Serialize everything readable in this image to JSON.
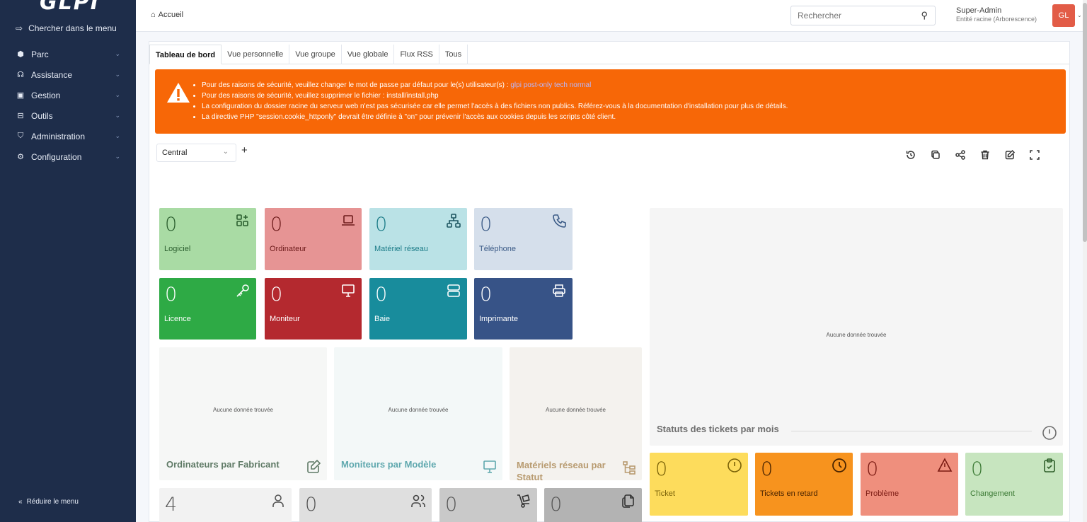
{
  "sidebar": {
    "logo": "GLPI",
    "search_menu": "Chercher dans le menu",
    "items": [
      {
        "label": "Parc",
        "icon": "cube-icon"
      },
      {
        "label": "Assistance",
        "icon": "headset-icon"
      },
      {
        "label": "Gestion",
        "icon": "wallet-icon"
      },
      {
        "label": "Outils",
        "icon": "briefcase-icon"
      },
      {
        "label": "Administration",
        "icon": "shield-icon"
      },
      {
        "label": "Configuration",
        "icon": "settings-icon"
      }
    ],
    "collapse": "Réduire le menu"
  },
  "header": {
    "breadcrumb": "Accueil",
    "search_placeholder": "Rechercher",
    "user_role": "Super-Admin",
    "user_entity": "Entité racine (Arborescence)",
    "avatar_initials": "GL"
  },
  "tabs": [
    "Tableau de bord",
    "Vue personnelle",
    "Vue groupe",
    "Vue globale",
    "Flux RSS",
    "Tous"
  ],
  "alert": {
    "line1_text": "Pour des raisons de sécurité, veuillez changer le mot de passe par défaut pour le(s) utilisateur(s) :",
    "line1_users": "glpi post-only tech normal",
    "line2": "Pour des raisons de sécurité, veuillez supprimer le fichier : install/install.php",
    "line3": "La configuration du dossier racine du serveur web n'est pas sécurisée car elle permet l'accès à des fichiers non publics. Référez-vous à la documentation d'installation pour plus de détails.",
    "line4": "La directive PHP \"session.cookie_httponly\" devrait être définie à \"on\" pour prévenir l'accès aux cookies depuis les scripts côté client."
  },
  "dashboard": {
    "selected": "Central",
    "add": "+"
  },
  "cards": {
    "logiciel": {
      "value": "0",
      "label": "Logiciel",
      "color": "#a9dba4"
    },
    "ordinateur": {
      "value": "0",
      "label": "Ordinateur",
      "color": "#e69494"
    },
    "materiel": {
      "value": "0",
      "label": "Matériel réseau",
      "color": "#bae2e6"
    },
    "telephone": {
      "value": "0",
      "label": "Téléphone",
      "color": "#d5dfeb"
    },
    "licence": {
      "value": "0",
      "label": "Licence",
      "color": "#2eaa45"
    },
    "moniteur": {
      "value": "0",
      "label": "Moniteur",
      "color": "#b4292f"
    },
    "baie": {
      "value": "0",
      "label": "Baie",
      "color": "#188c9c"
    },
    "imprimante": {
      "value": "0",
      "label": "Imprimante",
      "color": "#375387"
    },
    "ticket": {
      "value": "0",
      "label": "Ticket",
      "color": "#fddc5c"
    },
    "retard": {
      "value": "0",
      "label": "Tickets en retard",
      "color": "#f7931e"
    },
    "probleme": {
      "value": "0",
      "label": "Problème",
      "color": "#ef8f7d"
    },
    "changement": {
      "value": "0",
      "label": "Changement",
      "color": "#c7e5bf"
    },
    "users": {
      "value": "4"
    },
    "groups": {
      "value": "0"
    },
    "suppliers": {
      "value": "0"
    },
    "docs": {
      "value": "0"
    }
  },
  "widgets": {
    "empty": "Aucune donnée trouvée",
    "ord_fab": "Ordinateurs par Fabricant",
    "mon_mod": "Moniteurs par Modèle",
    "mat_stat": "Matériels réseau par Statut",
    "tickets_mois": "Statuts des tickets par mois"
  }
}
